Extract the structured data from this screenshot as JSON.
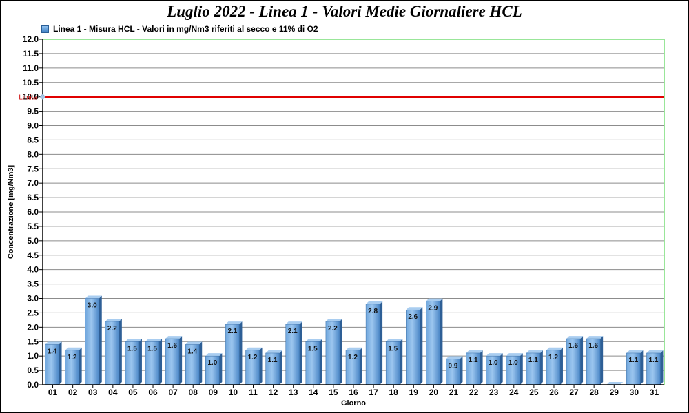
{
  "chart_data": {
    "type": "bar",
    "title": "Luglio 2022 - Linea 1 - Valori Medie Giornaliere HCL",
    "xlabel": "Giorno",
    "ylabel": "Concentrazione [mg/Nm3]",
    "ylim": [
      0,
      12
    ],
    "y_ticks": [
      "0.0",
      "0.5",
      "1.0",
      "1.5",
      "2.0",
      "2.5",
      "3.0",
      "3.5",
      "4.0",
      "4.5",
      "5.0",
      "5.5",
      "6.0",
      "6.5",
      "7.0",
      "7.5",
      "8.0",
      "8.5",
      "9.0",
      "9.5",
      "10.0",
      "10.5",
      "11.0",
      "11.5",
      "12.0"
    ],
    "grid": true,
    "legend_position": "top-left",
    "categories": [
      "01",
      "02",
      "03",
      "04",
      "05",
      "06",
      "07",
      "08",
      "09",
      "10",
      "11",
      "12",
      "13",
      "14",
      "15",
      "16",
      "17",
      "18",
      "19",
      "20",
      "21",
      "22",
      "23",
      "24",
      "25",
      "26",
      "27",
      "28",
      "29",
      "30",
      "31"
    ],
    "series": [
      {
        "name": "Linea 1 - Misura HCL - Valori in mg/Nm3 riferiti al secco e 11% di O2",
        "color": "#5b9bd5",
        "values": [
          1.4,
          1.2,
          3.0,
          2.2,
          1.5,
          1.5,
          1.6,
          1.4,
          1.0,
          2.1,
          1.2,
          1.1,
          2.1,
          1.5,
          2.2,
          1.2,
          2.8,
          1.5,
          2.6,
          2.9,
          0.9,
          1.1,
          1.0,
          1.0,
          1.1,
          1.2,
          1.6,
          1.6,
          0.0,
          1.1,
          1.1
        ],
        "labels": [
          "1.4",
          "1.2",
          "3.0",
          "2.2",
          "1.5",
          "1.5",
          "1.6",
          "1.4",
          "1.0",
          "2.1",
          "1.2",
          "1.1",
          "2.1",
          "1.5",
          "2.2",
          "1.2",
          "2.8",
          "1.5",
          "2.6",
          "2.9",
          "0.9",
          "1.1",
          "1.0",
          "1.0",
          "1.1",
          "1.2",
          "1.6",
          "1.6",
          "",
          "1.1",
          "1.1"
        ]
      }
    ],
    "limit": {
      "label": "Limite",
      "value": 10,
      "color": "#e00000"
    },
    "plot_border_color": "#33cc33"
  }
}
